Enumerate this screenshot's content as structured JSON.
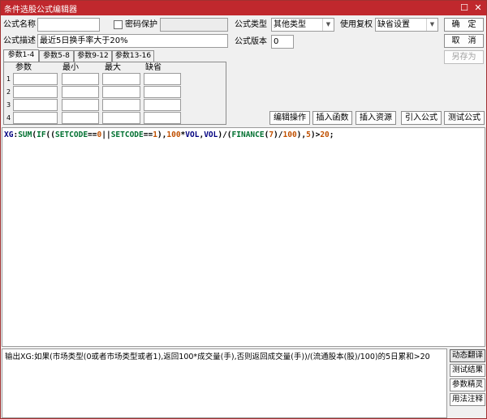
{
  "window": {
    "title": "条件选股公式编辑器",
    "restore_glyph": "☐",
    "close_glyph": "✕"
  },
  "form": {
    "name_label": "公式名称",
    "name_value": "",
    "password_label": "密码保护",
    "password_checked": false,
    "password_value": "",
    "desc_label": "公式描述",
    "desc_value": "最近5日换手率大于20%",
    "type_label": "公式类型",
    "type_value": "其他类型",
    "restore_label": "使用复权",
    "restore_value": "缺省设置",
    "version_label": "公式版本",
    "version_value": "0"
  },
  "actions": {
    "ok": "确　定",
    "cancel": "取　消",
    "save_as": "另存为"
  },
  "param_tabs": [
    "参数1-4",
    "参数5-8",
    "参数9-12",
    "参数13-16"
  ],
  "param_table": {
    "headers": [
      "参数",
      "最小",
      "最大",
      "缺省"
    ],
    "rows": [
      "1",
      "2",
      "3",
      "4"
    ]
  },
  "toolbar": {
    "edit_ops": "编辑操作",
    "insert_func": "插入函数",
    "insert_res": "插入资源",
    "import_formula": "引入公式",
    "test_formula": "测试公式"
  },
  "code": {
    "tokens": [
      {
        "t": "XG",
        "c": "id"
      },
      {
        "t": ":",
        "c": "op"
      },
      {
        "t": "SUM",
        "c": "fn"
      },
      {
        "t": "(",
        "c": "op"
      },
      {
        "t": "IF",
        "c": "fn"
      },
      {
        "t": "((",
        "c": "op"
      },
      {
        "t": "SETCODE",
        "c": "fn"
      },
      {
        "t": "==",
        "c": "op"
      },
      {
        "t": "0",
        "c": "num"
      },
      {
        "t": "||",
        "c": "op"
      },
      {
        "t": "SETCODE",
        "c": "fn"
      },
      {
        "t": "==",
        "c": "op"
      },
      {
        "t": "1",
        "c": "num"
      },
      {
        "t": "),",
        "c": "op"
      },
      {
        "t": "100",
        "c": "num"
      },
      {
        "t": "*",
        "c": "op"
      },
      {
        "t": "VOL",
        "c": "var"
      },
      {
        "t": ",",
        "c": "op"
      },
      {
        "t": "VOL",
        "c": "var"
      },
      {
        "t": ")/(",
        "c": "op"
      },
      {
        "t": "FINANCE",
        "c": "fn"
      },
      {
        "t": "(",
        "c": "op"
      },
      {
        "t": "7",
        "c": "num"
      },
      {
        "t": ")/",
        "c": "op"
      },
      {
        "t": "100",
        "c": "num"
      },
      {
        "t": "),",
        "c": "op"
      },
      {
        "t": "5",
        "c": "num"
      },
      {
        "t": ")>",
        "c": "op"
      },
      {
        "t": "20",
        "c": "num"
      },
      {
        "t": ";",
        "c": "op"
      }
    ]
  },
  "explanation": "输出XG:如果(市场类型(0或者市场类型或者1),返回100*成交量(手),否则返回成交量(手))/(流通股本(股)/100)的5日累和>20",
  "side_buttons": {
    "translate": "动态翻译",
    "test_result": "测试结果",
    "param_wizard": "参数精灵",
    "usage_notes": "用法注释"
  },
  "colors": {
    "title_bar": "#c0282d",
    "function": "#007030",
    "number": "#c05000",
    "variable": "#000080"
  }
}
